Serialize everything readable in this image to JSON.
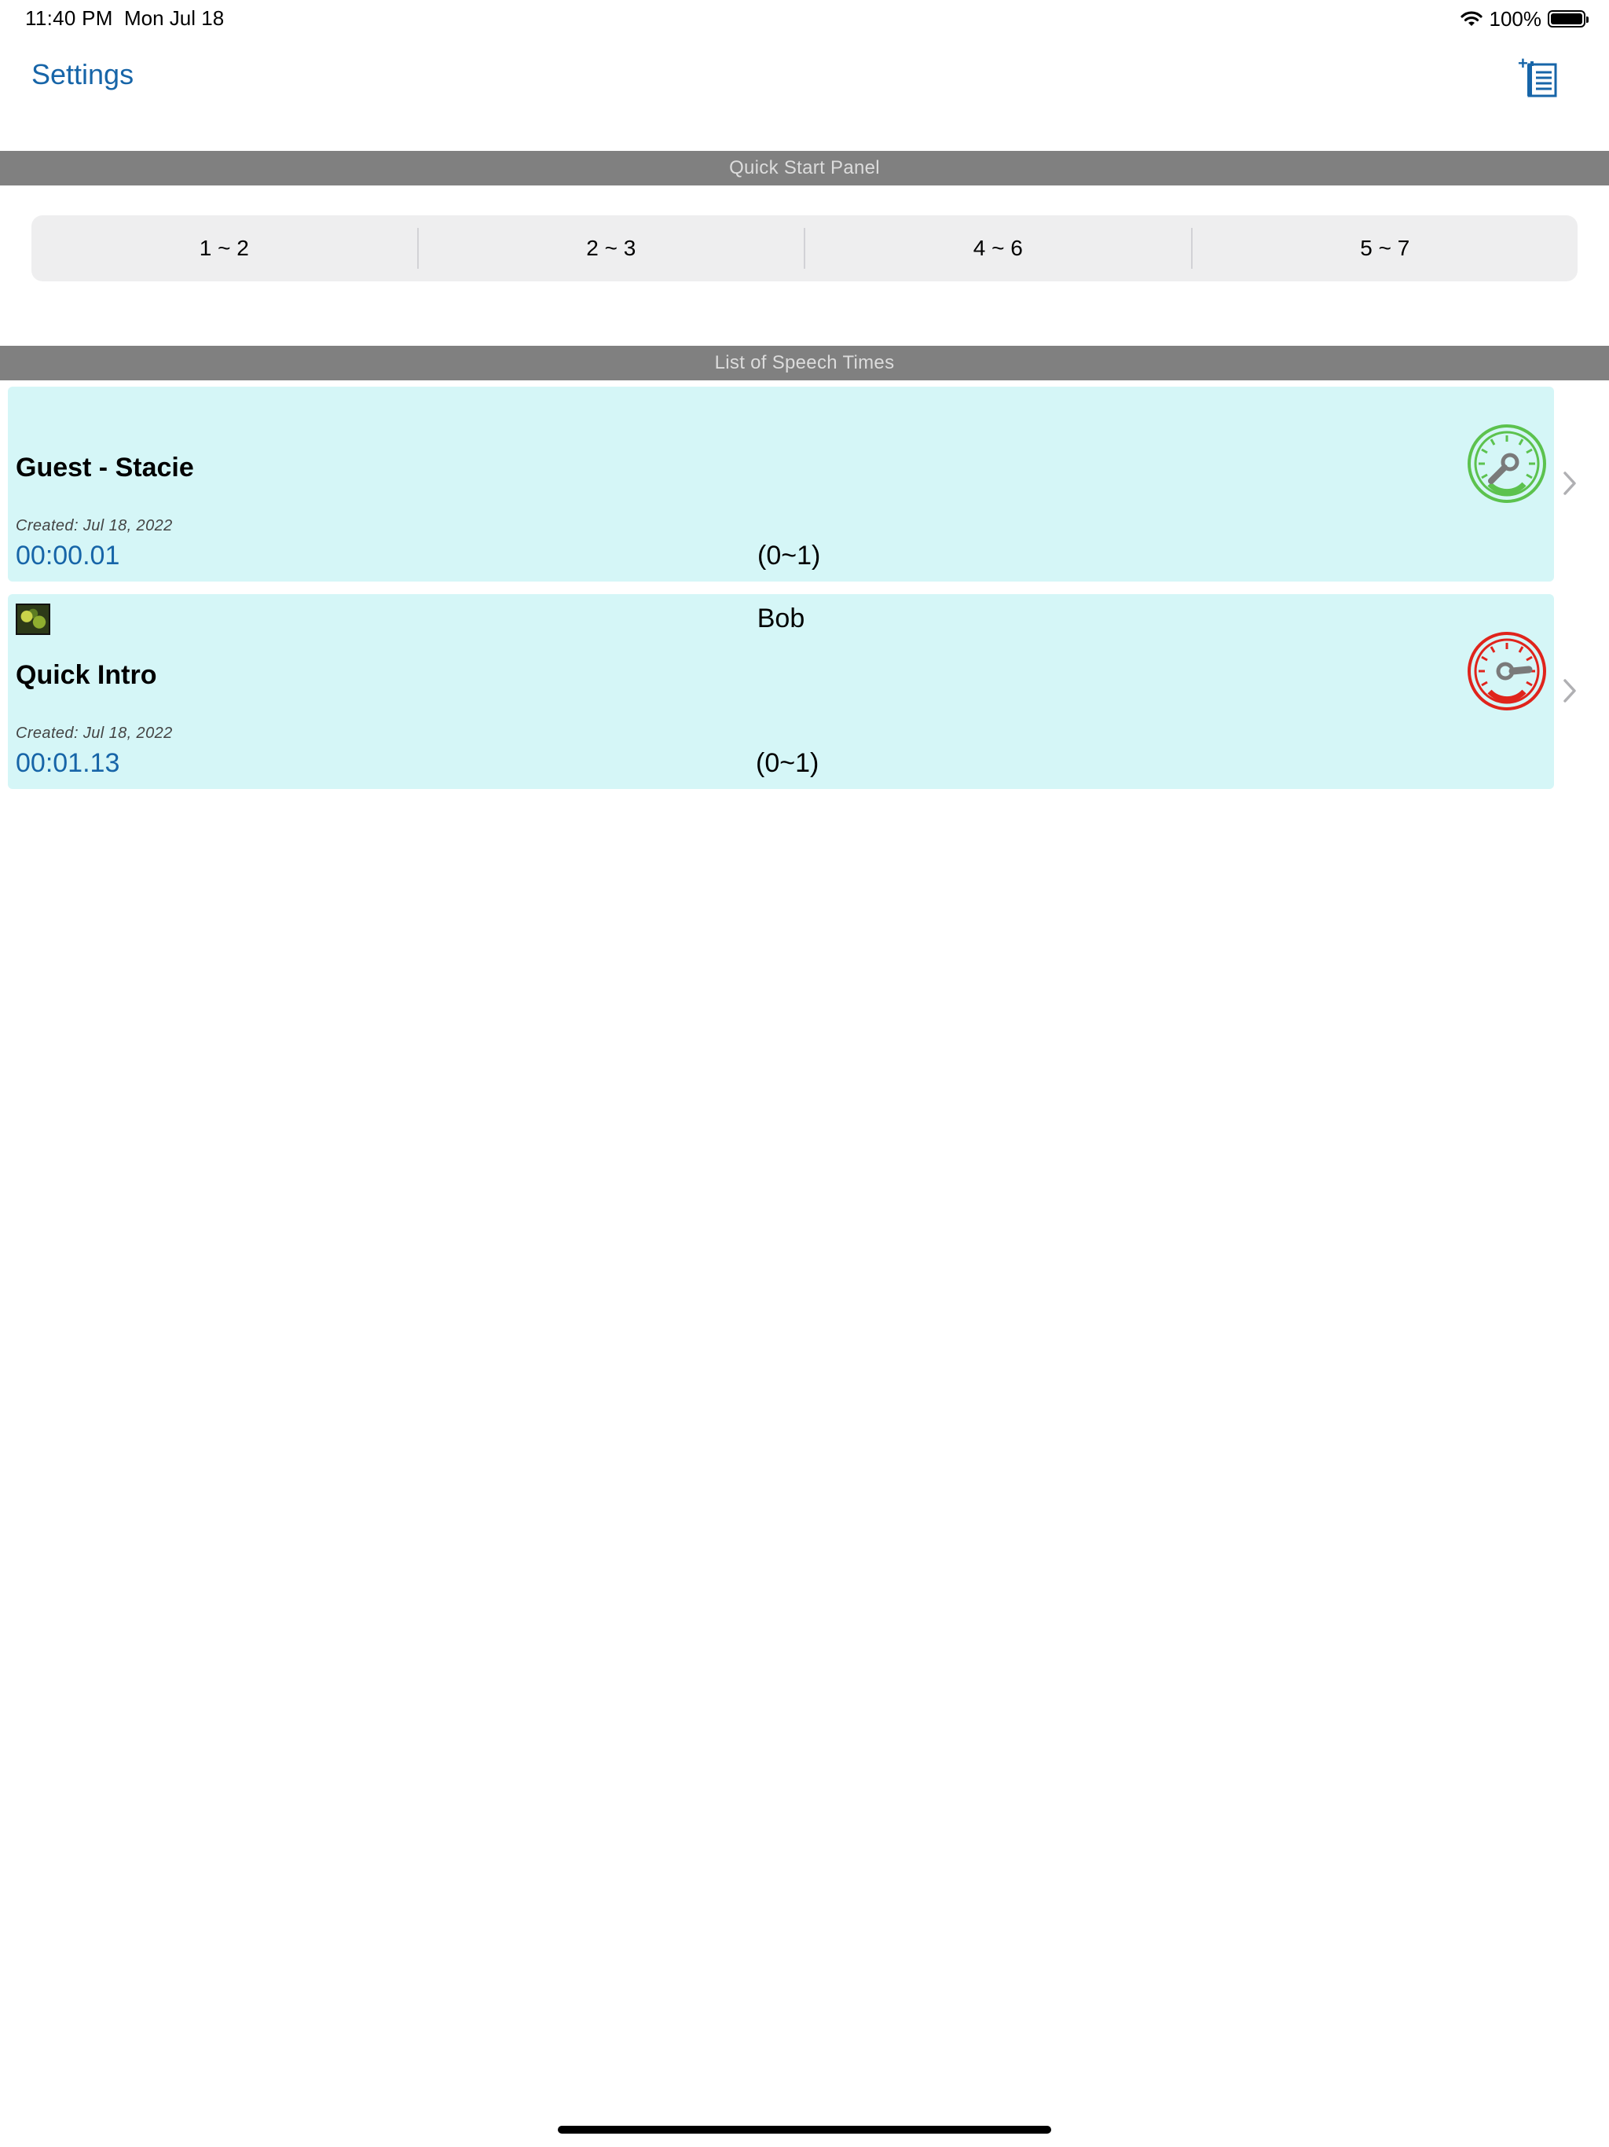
{
  "status_bar": {
    "time": "11:40 PM",
    "date": "Mon Jul 18",
    "battery": "100%",
    "icons": [
      "wifi-icon",
      "battery-icon"
    ]
  },
  "nav": {
    "settings_label": "Settings",
    "add_icon": "add-list-icon"
  },
  "quick_start": {
    "header": "Quick Start Panel",
    "segments": [
      "1 ~ 2",
      "2 ~ 3",
      "4 ~ 6",
      "5 ~ 7"
    ]
  },
  "speech_list": {
    "header": "List of Speech Times",
    "items": [
      {
        "speaker": "",
        "title": "Guest - Stacie",
        "created": "Created:  Jul 18, 2022",
        "elapsed": "00:00.01",
        "range": "(0~1)",
        "gauge_color": "#5cc24e",
        "gauge_icon": "green-gauge-icon"
      },
      {
        "speaker": "Bob",
        "title": "Quick Intro",
        "created": "Created:  Jul 18, 2022",
        "elapsed": "00:01.13",
        "range": "(0~1)",
        "gauge_color": "#e0241c",
        "gauge_icon": "red-gauge-icon"
      }
    ]
  },
  "colors": {
    "accent": "#1765a8",
    "section_header_bg": "#808080",
    "card_bg": "#d5f6f7"
  }
}
